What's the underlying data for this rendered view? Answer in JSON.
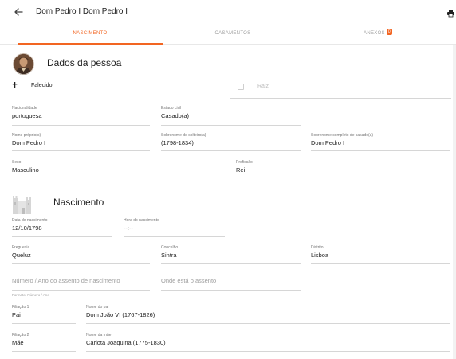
{
  "header": {
    "title": "Dom Pedro I Dom Pedro I"
  },
  "tabs": [
    {
      "label": "NASCIMENTO"
    },
    {
      "label": "CASAMENTOS"
    },
    {
      "label": "ANEXOS",
      "badge": "0"
    }
  ],
  "colors": {
    "accent": "#f26522"
  },
  "icons": {
    "back": "arrow-left-icon",
    "print": "print-icon",
    "deceased": "cross-icon",
    "birth": "castle-icon"
  },
  "person": {
    "section_title": "Dados da pessoa",
    "deceased_label": "Falecido",
    "root_label": "Raiz",
    "root_checked": false,
    "nacionalidade": {
      "label": "Nacionalidade",
      "value": "portuguesa"
    },
    "estado_civil": {
      "label": "Estado civil",
      "value": "Casado(a)"
    },
    "nome_proprio": {
      "label": "Nome próprio(s)",
      "value": "Dom Pedro I"
    },
    "sobrenome_solteiro": {
      "label": "Sobrenome de solteiro(a)",
      "value": "(1798-1834)"
    },
    "sobrenome_casado": {
      "label": "Sobrenome completo de casado(a)",
      "value": "Dom Pedro I"
    },
    "sexo": {
      "label": "Sexo",
      "value": "Masculino"
    },
    "profissao": {
      "label": "Profissão",
      "value": "Rei"
    }
  },
  "birth": {
    "section_title": "Nascimento",
    "data": {
      "label": "Data de nascimento",
      "value": "12/10/1798"
    },
    "hora": {
      "label": "Hora do nascimento",
      "value": "--:--"
    },
    "freguesia": {
      "label": "Freguesia",
      "value": "Queluz"
    },
    "concelho": {
      "label": "Concelho",
      "value": "Sintra"
    },
    "distrito": {
      "label": "Distrito",
      "value": "Lisboa"
    },
    "assento_placeholder": "Número / Ano do assento de nascimento",
    "local_placeholder": "Onde está o assento",
    "format_hint": "Formato: Número / Ano",
    "filiacao1": {
      "label": "Filiação 1",
      "value": "Pai"
    },
    "pai": {
      "label": "Nome do pai",
      "value": "Dom João VI (1767-1826)"
    },
    "filiacao2": {
      "label": "Filiação 2",
      "value": "Mãe"
    },
    "mae": {
      "label": "Nome da mãe",
      "value": "Carlota Joaquina (1775-1830)"
    }
  }
}
